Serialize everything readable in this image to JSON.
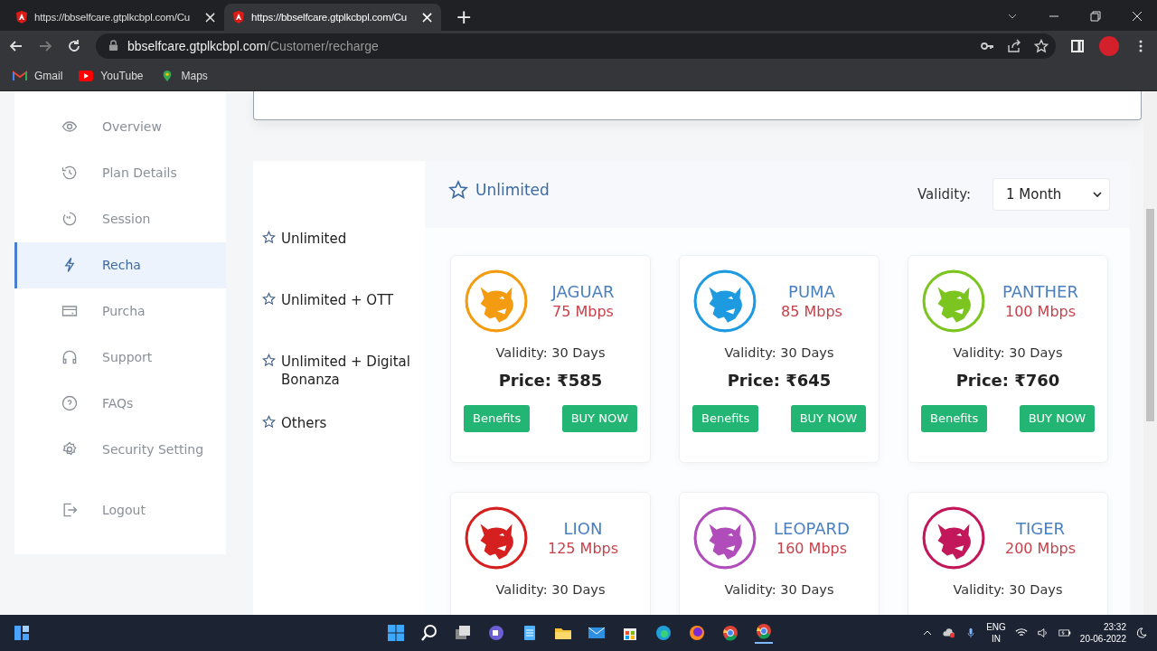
{
  "browser": {
    "tabs": [
      {
        "title": "https://bbselfcare.gtplkcbpl.com/Cu",
        "close": "×",
        "selected": false
      },
      {
        "title": "https://bbselfcare.gtplkcbpl.com/Cu",
        "close": "×",
        "selected": true
      }
    ],
    "new_tab": "+",
    "url_host": "bbselfcare.gtplkcbpl.com",
    "url_path": "/Customer/recharge",
    "bookmarks": [
      "Gmail",
      "YouTube",
      "Maps"
    ]
  },
  "sidebar": {
    "items": [
      {
        "label": "Overview",
        "selected": false
      },
      {
        "label": "Plan Details",
        "selected": false
      },
      {
        "label": "Session",
        "selected": false
      },
      {
        "label": "Recha",
        "selected": true
      },
      {
        "label": "Purcha",
        "selected": false
      },
      {
        "label": "Support",
        "selected": false
      },
      {
        "label": "FAQs",
        "selected": false
      },
      {
        "label": "Security Setting",
        "selected": false
      }
    ],
    "logout": "Logout"
  },
  "categories": [
    "Unlimited",
    "Unlimited + OTT",
    "Unlimited + Digital Bonanza",
    "Others"
  ],
  "plans_header": {
    "title": "Unlimited",
    "validity_label": "Validity:",
    "validity_value": "1 Month"
  },
  "plans": [
    {
      "name": "JAGUAR",
      "speed": "75 Mbps",
      "validity": "Validity: 30 Days",
      "price": "Price: ₹585",
      "benefits": "Benefits",
      "buy": "BUY NOW",
      "color": "#f39c12"
    },
    {
      "name": "PUMA",
      "speed": "85 Mbps",
      "validity": "Validity: 30 Days",
      "price": "Price: ₹645",
      "benefits": "Benefits",
      "buy": "BUY NOW",
      "color": "#1e9be0"
    },
    {
      "name": "PANTHER",
      "speed": "100 Mbps",
      "validity": "Validity: 30 Days",
      "price": "Price: ₹760",
      "benefits": "Benefits",
      "buy": "BUY NOW",
      "color": "#7cc520"
    },
    {
      "name": "LION",
      "speed": "125 Mbps",
      "validity": "Validity: 30 Days",
      "color": "#d6201f"
    },
    {
      "name": "LEOPARD",
      "speed": "160 Mbps",
      "validity": "Validity: 30 Days",
      "color": "#b04dba"
    },
    {
      "name": "TIGER",
      "speed": "200 Mbps",
      "validity": "Validity: 30 Days",
      "color": "#c2185b"
    }
  ],
  "taskbar": {
    "language": "ENG",
    "region": "IN",
    "time": "23:32",
    "date": "20-06-2022"
  }
}
